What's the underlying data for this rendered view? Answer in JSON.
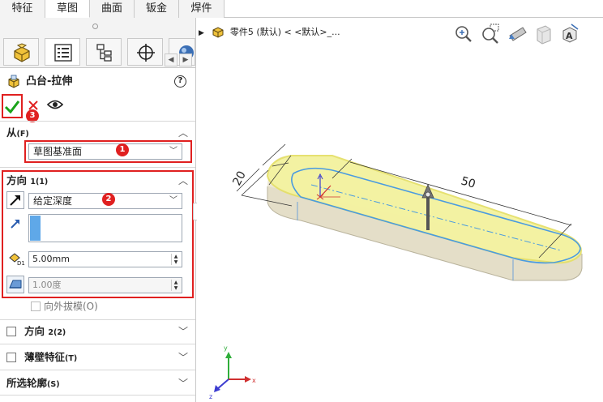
{
  "tabs": [
    "特征",
    "草图",
    "曲面",
    "钣金",
    "焊件"
  ],
  "active_tab": "草图",
  "feature": {
    "title": "凸台-拉伸",
    "help": "?"
  },
  "badges": [
    "1",
    "2",
    "3"
  ],
  "from": {
    "label": "从",
    "shortcut": "(F)",
    "value": "草图基准面"
  },
  "direction1": {
    "label": "方向",
    "shortcut": "1(1)",
    "end_condition": "给定深度",
    "depth": "5.00mm",
    "draft": "1.00度",
    "draft_outward": "向外拔模(O)"
  },
  "collapsed": [
    {
      "label": "方向",
      "shortcut": "2(2)"
    },
    {
      "label": "薄壁特征",
      "shortcut": "(T)"
    },
    {
      "label": "所选轮廓",
      "shortcut": "(S)"
    }
  ],
  "viewport": {
    "breadcrumb": "零件5 (默认) < <默认>_...",
    "dim_width": "20",
    "dim_length": "50"
  },
  "colors": {
    "accent_red": "#e02020",
    "confirm_green": "#1aa31a",
    "face_yellow": "#f4f3a0",
    "edge_blue": "#4a9be0"
  }
}
